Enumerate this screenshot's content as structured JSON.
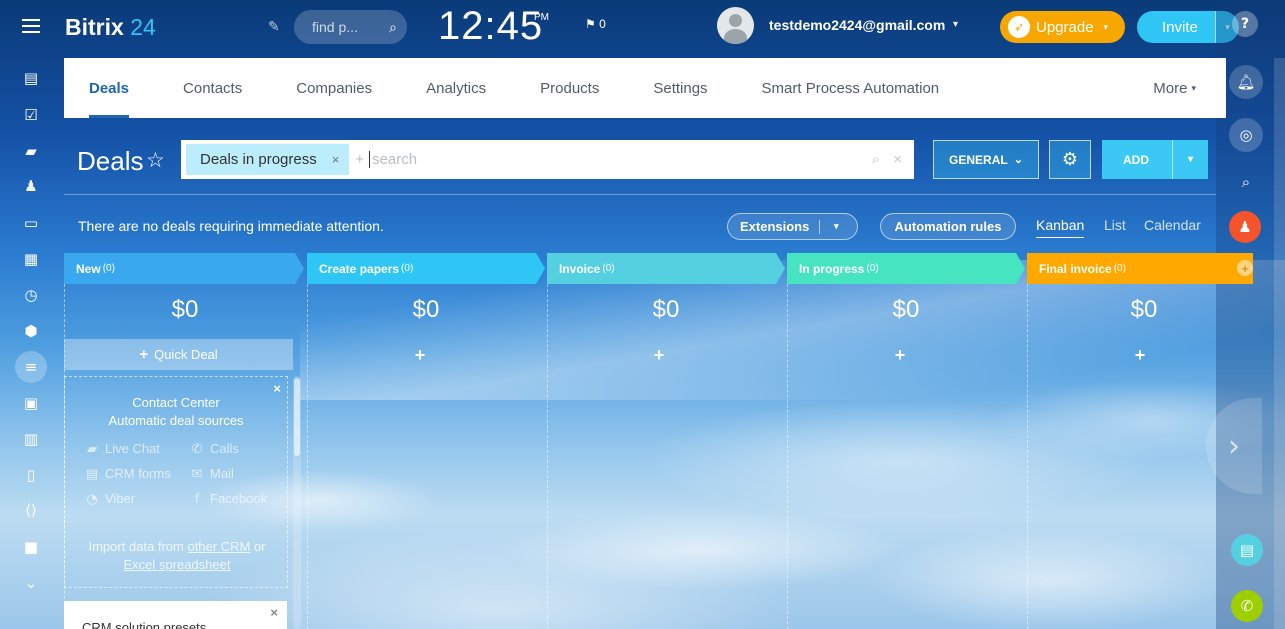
{
  "app": {
    "logo_text": "Bitrix",
    "logo_num": "24"
  },
  "header": {
    "search_placeholder": "find p...",
    "clock": "12:45",
    "clock_ampm": "PM",
    "flag_count": "0",
    "user_email": "testdemo2424@gmail.com",
    "upgrade_label": "Upgrade",
    "invite_label": "Invite",
    "help_label": "?"
  },
  "tabs": [
    {
      "label": "Deals",
      "active": true
    },
    {
      "label": "Contacts"
    },
    {
      "label": "Companies"
    },
    {
      "label": "Analytics"
    },
    {
      "label": "Products"
    },
    {
      "label": "Settings"
    },
    {
      "label": "Smart Process Automation"
    }
  ],
  "tabs_more": "More",
  "page": {
    "title": "Deals",
    "filter_chip": "Deals in progress",
    "filter_plus": "+",
    "filter_placeholder": "search",
    "general_label": "GENERAL",
    "add_label": "ADD",
    "attention_text": "There are no deals requiring immediate attention.",
    "extensions_label": "Extensions",
    "automation_label": "Automation rules",
    "views": [
      "Kanban",
      "List",
      "Calendar"
    ]
  },
  "stages": [
    {
      "name": "New",
      "count": "(0)",
      "total": "$0",
      "color": "#39a8ef"
    },
    {
      "name": "Create papers",
      "count": "(0)",
      "total": "$0",
      "color": "#2fc6f6"
    },
    {
      "name": "Invoice",
      "count": "(0)",
      "total": "$0",
      "color": "#55d0e0"
    },
    {
      "name": "In progress",
      "count": "(0)",
      "total": "$0",
      "color": "#47e4c2"
    },
    {
      "name": "Final invoice",
      "count": "(0)",
      "total": "$0",
      "color": "#ffa900"
    }
  ],
  "quick_deal_label": "Quick Deal",
  "contact_center": {
    "title1": "Contact Center",
    "title2": "Automatic deal sources",
    "sources": [
      "Live Chat",
      "Calls",
      "CRM forms",
      "Mail",
      "Viber",
      "Facebook"
    ],
    "import_pre": "Import data from",
    "import_link1": "other CRM",
    "import_mid": "or",
    "import_link2": "Excel spreadsheet"
  },
  "presets_title": "CRM solution presets",
  "close_glyph": "×"
}
